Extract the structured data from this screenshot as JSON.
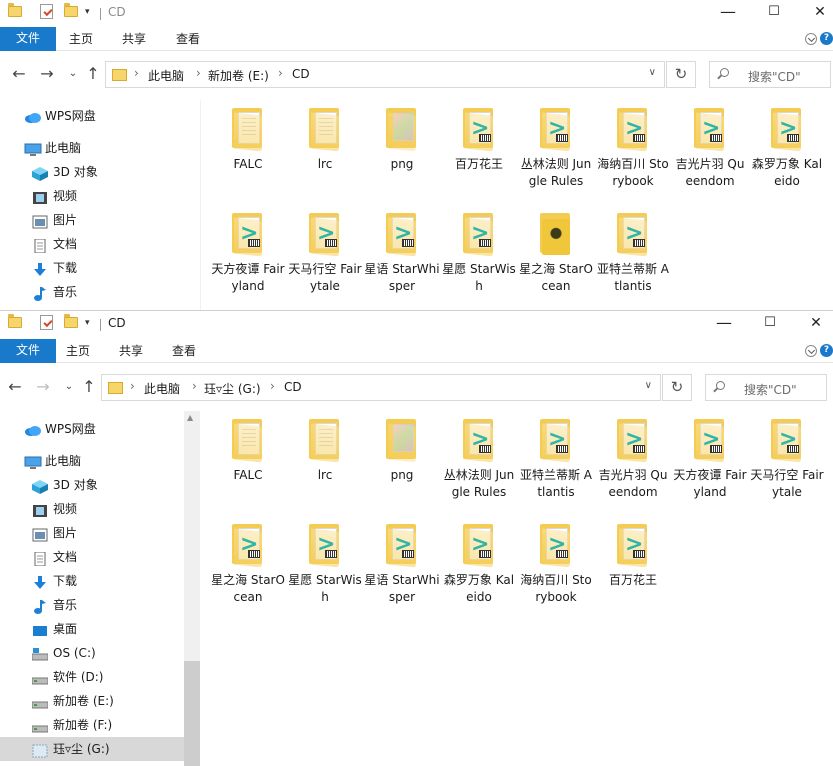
{
  "colors": {
    "accent": "#1979ca",
    "folder": "#f4cc54",
    "music": "#2fb5a6",
    "selected": "#d8d8d8"
  },
  "ribbon": {
    "file": "文件",
    "home": "主页",
    "share": "共享",
    "view": "查看"
  },
  "window_controls": {
    "minimize": "—",
    "maximize": "☐",
    "close": "✕"
  },
  "window1": {
    "title": "CD",
    "path": [
      "此电脑",
      "新加卷 (E:)",
      "CD"
    ],
    "search_placeholder": "搜索\"CD\"",
    "sidebar": [
      {
        "label": "WPS网盘",
        "icon": "cloud-icon"
      },
      {
        "label": "此电脑",
        "icon": "computer-icon"
      },
      {
        "label": "3D 对象",
        "icon": "cube-icon"
      },
      {
        "label": "视频",
        "icon": "video-icon"
      },
      {
        "label": "图片",
        "icon": "picture-icon"
      },
      {
        "label": "文档",
        "icon": "document-icon"
      },
      {
        "label": "下载",
        "icon": "download-icon"
      },
      {
        "label": "音乐",
        "icon": "music-icon"
      }
    ],
    "files": [
      {
        "name": "FALC",
        "kind": "folder-docs"
      },
      {
        "name": "lrc",
        "kind": "folder-docs"
      },
      {
        "name": "png",
        "kind": "folder-image"
      },
      {
        "name": "百万花王",
        "kind": "folder-music"
      },
      {
        "name": "丛林法则 Jungle Rules",
        "kind": "folder-music"
      },
      {
        "name": "海纳百川 Storybook",
        "kind": "folder-music"
      },
      {
        "name": "吉光片羽 Queendom",
        "kind": "folder-music"
      },
      {
        "name": "森罗万象 Kaleido",
        "kind": "folder-music"
      },
      {
        "name": "天方夜谭 Fairyland",
        "kind": "folder-music"
      },
      {
        "name": "天马行空 Fairytale",
        "kind": "folder-music"
      },
      {
        "name": "星语 StarWhisper",
        "kind": "folder-music"
      },
      {
        "name": "星愿 StarWish",
        "kind": "folder-music"
      },
      {
        "name": "星之海 StarOcean",
        "kind": "folder-art"
      },
      {
        "name": "亚特兰蒂斯 Atlantis",
        "kind": "folder-music"
      }
    ]
  },
  "window2": {
    "title": "CD",
    "path": [
      "此电脑",
      "珏▿尘 (G:)",
      "CD"
    ],
    "search_placeholder": "搜索\"CD\"",
    "sidebar": [
      {
        "label": "WPS网盘",
        "icon": "cloud-icon"
      },
      {
        "label": "此电脑",
        "icon": "computer-icon"
      },
      {
        "label": "3D 对象",
        "icon": "cube-icon"
      },
      {
        "label": "视频",
        "icon": "video-icon"
      },
      {
        "label": "图片",
        "icon": "picture-icon"
      },
      {
        "label": "文档",
        "icon": "document-icon"
      },
      {
        "label": "下载",
        "icon": "download-icon"
      },
      {
        "label": "音乐",
        "icon": "music-icon"
      },
      {
        "label": "桌面",
        "icon": "desktop-icon"
      },
      {
        "label": "OS (C:)",
        "icon": "os-drive-icon"
      },
      {
        "label": "软件 (D:)",
        "icon": "drive-icon"
      },
      {
        "label": "新加卷 (E:)",
        "icon": "drive-icon"
      },
      {
        "label": "新加卷 (F:)",
        "icon": "drive-icon"
      },
      {
        "label": "珏▿尘 (G:)",
        "icon": "usb-drive-icon",
        "selected": true
      }
    ],
    "files": [
      {
        "name": "FALC",
        "kind": "folder-docs"
      },
      {
        "name": "lrc",
        "kind": "folder-docs"
      },
      {
        "name": "png",
        "kind": "folder-image"
      },
      {
        "name": "丛林法则 Jungle Rules",
        "kind": "folder-music"
      },
      {
        "name": "亚特兰蒂斯 Atlantis",
        "kind": "folder-music"
      },
      {
        "name": "吉光片羽 Queendom",
        "kind": "folder-music"
      },
      {
        "name": "天方夜谭 Fairyland",
        "kind": "folder-music"
      },
      {
        "name": "天马行空 Fairytale",
        "kind": "folder-music"
      },
      {
        "name": "星之海 StarOcean",
        "kind": "folder-music"
      },
      {
        "name": "星愿 StarWish",
        "kind": "folder-music"
      },
      {
        "name": "星语 StarWhisper",
        "kind": "folder-music"
      },
      {
        "name": "森罗万象 Kaleido",
        "kind": "folder-music"
      },
      {
        "name": "海纳百川 Storybook",
        "kind": "folder-music"
      },
      {
        "name": "百万花王",
        "kind": "folder-music"
      }
    ]
  }
}
